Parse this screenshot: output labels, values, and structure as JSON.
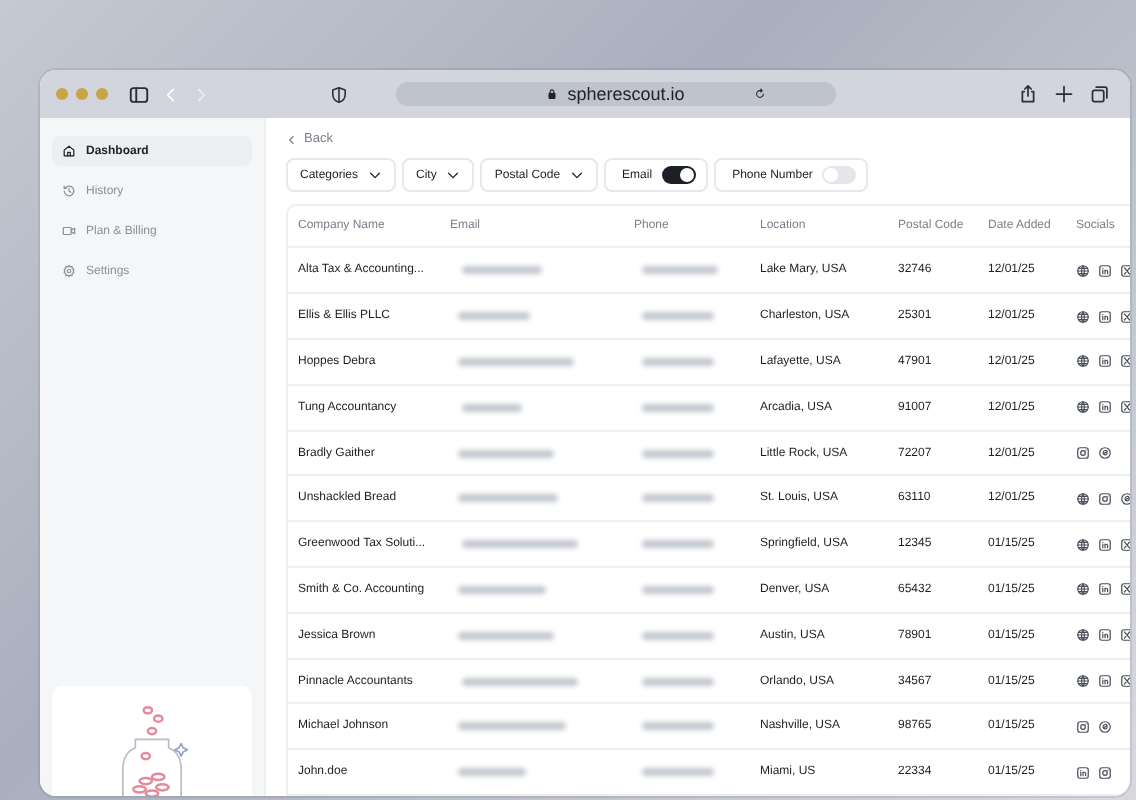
{
  "browser": {
    "url": "spherescout.io"
  },
  "sidebar": {
    "items": [
      {
        "label": "Dashboard",
        "selected": true
      },
      {
        "label": "History",
        "selected": false
      },
      {
        "label": "Plan & Billing",
        "selected": false
      },
      {
        "label": "Settings",
        "selected": false
      }
    ]
  },
  "back": "Back",
  "filters": [
    {
      "kind": "dropdown",
      "label": "Categories"
    },
    {
      "kind": "dropdown",
      "label": "City"
    },
    {
      "kind": "dropdown",
      "label": "Postal Code"
    },
    {
      "kind": "toggle",
      "label": "Email",
      "on": true
    },
    {
      "kind": "toggle",
      "label": "Phone Number",
      "on": false
    }
  ],
  "table": {
    "columns": [
      "Company Name",
      "Email",
      "Phone",
      "Location",
      "Postal Code",
      "Date Added",
      "Socials"
    ],
    "rows": [
      {
        "company": "Alta Tax & Accounting...",
        "location": "Lake Mary, USA",
        "postal_code": "32746",
        "date_added": "12/01/25",
        "socials": [
          {
            "kind": "web"
          },
          {
            "kind": "linkedin"
          },
          {
            "kind": "x"
          }
        ]
      },
      {
        "company": "Ellis & Ellis PLLC",
        "location": "Charleston, USA",
        "postal_code": "25301",
        "date_added": "12/01/25",
        "socials": [
          {
            "kind": "web"
          },
          {
            "kind": "linkedin"
          },
          {
            "kind": "x"
          }
        ]
      },
      {
        "company": "Hoppes Debra",
        "location": "Lafayette, USA",
        "postal_code": "47901",
        "date_added": "12/01/25",
        "socials": [
          {
            "kind": "web"
          },
          {
            "kind": "linkedin"
          },
          {
            "kind": "x"
          }
        ]
      },
      {
        "company": "Tung Accountancy",
        "location": "Arcadia, USA",
        "postal_code": "91007",
        "date_added": "12/01/25",
        "socials": [
          {
            "kind": "web"
          },
          {
            "kind": "linkedin"
          },
          {
            "kind": "x"
          }
        ]
      },
      {
        "company": "Bradly Gaither",
        "location": "Little Rock, USA",
        "postal_code": "72207",
        "date_added": "12/01/25",
        "socials": [
          {
            "kind": "instagram"
          },
          {
            "kind": "threads"
          }
        ]
      },
      {
        "company": "Unshackled Bread",
        "location": "St. Louis, USA",
        "postal_code": "63110",
        "date_added": "12/01/25",
        "socials": [
          {
            "kind": "web"
          },
          {
            "kind": "instagram"
          },
          {
            "kind": "threads"
          }
        ]
      },
      {
        "company": "Greenwood Tax Soluti...",
        "location": "Springfield, USA",
        "postal_code": "12345",
        "date_added": "01/15/25",
        "socials": [
          {
            "kind": "web"
          },
          {
            "kind": "linkedin"
          },
          {
            "kind": "x"
          }
        ]
      },
      {
        "company": "Smith & Co. Accounting",
        "location": "Denver, USA",
        "postal_code": "65432",
        "date_added": "01/15/25",
        "socials": [
          {
            "kind": "web"
          },
          {
            "kind": "linkedin"
          },
          {
            "kind": "x"
          }
        ]
      },
      {
        "company": "Jessica Brown",
        "location": "Austin, USA",
        "postal_code": "78901",
        "date_added": "01/15/25",
        "socials": [
          {
            "kind": "web"
          },
          {
            "kind": "linkedin"
          },
          {
            "kind": "x"
          }
        ]
      },
      {
        "company": "Pinnacle Accountants",
        "location": "Orlando, USA",
        "postal_code": "34567",
        "date_added": "01/15/25",
        "socials": [
          {
            "kind": "web"
          },
          {
            "kind": "linkedin"
          },
          {
            "kind": "x"
          }
        ]
      },
      {
        "company": "Michael Johnson",
        "location": "Nashville, USA",
        "postal_code": "98765",
        "date_added": "01/15/25",
        "socials": [
          {
            "kind": "instagram"
          },
          {
            "kind": "threads"
          }
        ]
      },
      {
        "company": "John.doe",
        "location": "Miami, US",
        "postal_code": "22334",
        "date_added": "01/15/25",
        "socials": [
          {
            "kind": "linkedin"
          },
          {
            "kind": "instagram"
          }
        ]
      }
    ]
  }
}
